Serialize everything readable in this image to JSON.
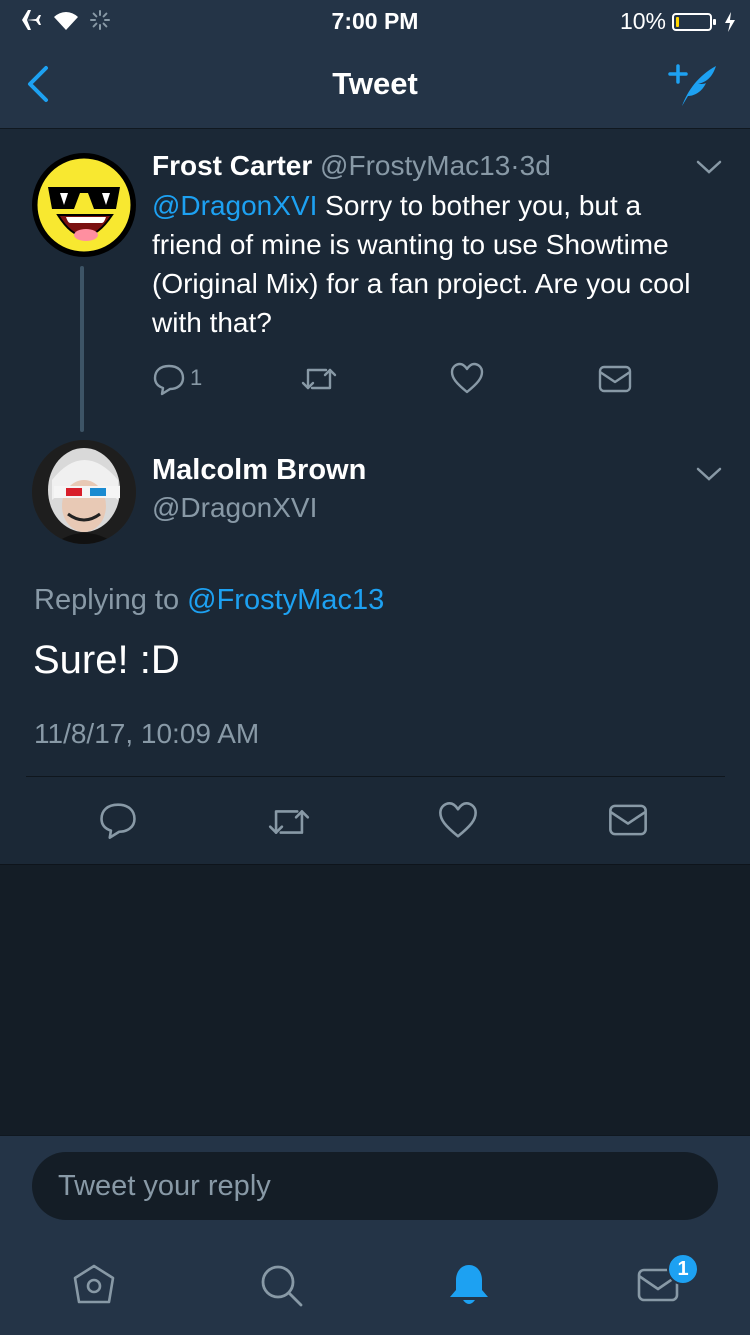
{
  "status_bar": {
    "time": "7:00 PM",
    "battery_percent_text": "10%",
    "battery_level": 0.1,
    "icons": [
      "airplane-icon",
      "wifi-icon",
      "activity-spinner-icon",
      "charging-bolt-icon"
    ]
  },
  "nav": {
    "title": "Tweet",
    "back_icon": "chevron-left-icon",
    "compose_icon": "compose-tweet-icon"
  },
  "parent_tweet": {
    "author_name": "Frost Carter",
    "author_handle": "@FrostyMac13",
    "separator": "·",
    "age": "3d",
    "mention": "@DragonXVI",
    "text": " Sorry to bother you, but a friend of mine is wanting to use Showtime (Original Mix) for a fan project. Are you cool with that?",
    "reply_count": "1",
    "avatar_icon": "sunglasses-emoji-avatar"
  },
  "main_tweet": {
    "author_name": "Malcolm Brown",
    "author_handle": "@DragonXVI",
    "replying_prefix": "Replying to ",
    "replying_to": "@FrostyMac13",
    "text": "Sure! :D",
    "timestamp": "11/8/17, 10:09 AM",
    "avatar_icon": "character-portrait-avatar"
  },
  "reply_box": {
    "placeholder": "Tweet your reply"
  },
  "tab_bar": {
    "tabs": [
      "home",
      "search",
      "notifications",
      "messages"
    ],
    "active": "notifications",
    "messages_badge": "1"
  },
  "colors": {
    "background": "#141d26",
    "card": "#1b2836",
    "bar": "#243447",
    "accent": "#1da1f2",
    "muted": "#8899a6"
  }
}
